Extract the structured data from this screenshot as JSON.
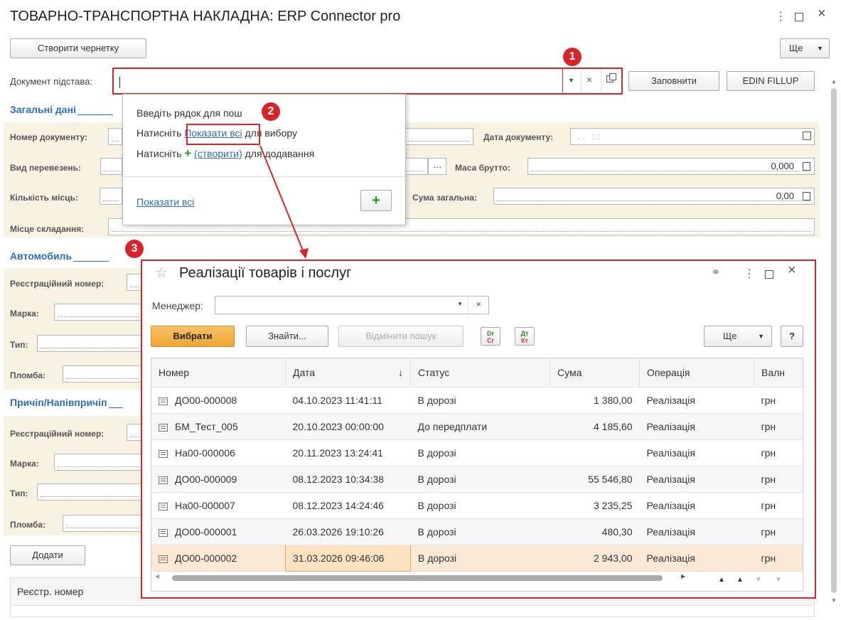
{
  "window": {
    "title": "ТОВАРНО-ТРАНСПОРТНА НАКЛАДНА: ERP Connector pro"
  },
  "toolbar": {
    "create_draft": "Створити чернетку",
    "more": "Ще"
  },
  "basis": {
    "label": "Документ підстава:",
    "fill": "Заповнити",
    "edin": "EDIN FILLUP"
  },
  "dropdown": {
    "line1": "Введіть рядок для пош",
    "line2_pre": "Натисніть ",
    "line2_link": "Показати всі",
    "line2_post": " для вибору",
    "line3_pre": "Натисніть ",
    "line3_link": "(створити)",
    "line3_post": " для додавання",
    "show_all": "Показати всі"
  },
  "general": {
    "section": "Загальні дані",
    "doc_number": "Номер документу:",
    "doc_date": "Дата документу:",
    "date_value": ". .   : :",
    "transport": "Вид перевезень:",
    "gross_mass": "Маса брутто:",
    "gross_mass_value": "0,000",
    "places": "Кількість місць:",
    "total_sum": "Сума загальна:",
    "total_sum_value": "0,00",
    "place": "Місце складання:"
  },
  "car": {
    "section": "Автомобиль",
    "reg": "Реєстраційний номер:",
    "brand": "Марка:",
    "type": "Тип:",
    "seal": "Пломба:"
  },
  "trailer": {
    "section": "Причіп/Напівпричіп",
    "reg": "Реєстраційний номер:",
    "brand": "Марка:",
    "type": "Тип:",
    "seal": "Пломба:",
    "add": "Додати",
    "col_reg": "Реєстр. номер"
  },
  "badges": [
    "1",
    "2",
    "3"
  ],
  "popup": {
    "title": "Реалізації товарів і послуг",
    "manager_label": "Менеджер:",
    "select": "Вибрати",
    "find": "Знайти...",
    "cancel_search": "Відмінити пошук",
    "more": "Ще",
    "help": "?",
    "dr_cr_top": "Dr",
    "dr_cr_bot": "Cr",
    "dt_kt_top": "Дт",
    "dt_kt_bot": "Кт",
    "columns": [
      "Номер",
      "Дата",
      "Статус",
      "Сума",
      "Операція",
      "Валн"
    ],
    "rows": [
      {
        "num": "ДО00-000008",
        "date": "04.10.2023 11:41:11",
        "status": "В дорозі",
        "sum": "1 380,00",
        "op": "Реалізація",
        "cur": "грн"
      },
      {
        "num": "БМ_Тест_005",
        "date": "20.10.2023 00:00:00",
        "status": "До передплати",
        "sum": "4 185,60",
        "op": "Реалізація",
        "cur": "грн"
      },
      {
        "num": "На00-000006",
        "date": "20.11.2023 13:24:41",
        "status": "В дорозі",
        "sum": "",
        "op": "Реалізація",
        "cur": "грн"
      },
      {
        "num": "ДО00-000009",
        "date": "08.12.2023 10:34:38",
        "status": "В дорозі",
        "sum": "55 546,80",
        "op": "Реалізація",
        "cur": "грн"
      },
      {
        "num": "На00-000007",
        "date": "08.12.2023 14:24:46",
        "status": "В дорозі",
        "sum": "3 235,25",
        "op": "Реалізація",
        "cur": "грн"
      },
      {
        "num": "ДО00-000001",
        "date": "26.03.2026 19:10:26",
        "status": "В дорозі",
        "sum": "480,30",
        "op": "Реалізація",
        "cur": "грн"
      },
      {
        "num": "ДО00-000002",
        "date": "31.03.2026 09:46:06",
        "status": "В дорозі",
        "sum": "2 943,00",
        "op": "Реалізація",
        "cur": "грн"
      }
    ]
  },
  "colors": {
    "accent_red": "#d8232a",
    "link_blue": "#2a6cc0",
    "select_orange": "#f3b24a",
    "selected_row": "#fbe9d6"
  }
}
